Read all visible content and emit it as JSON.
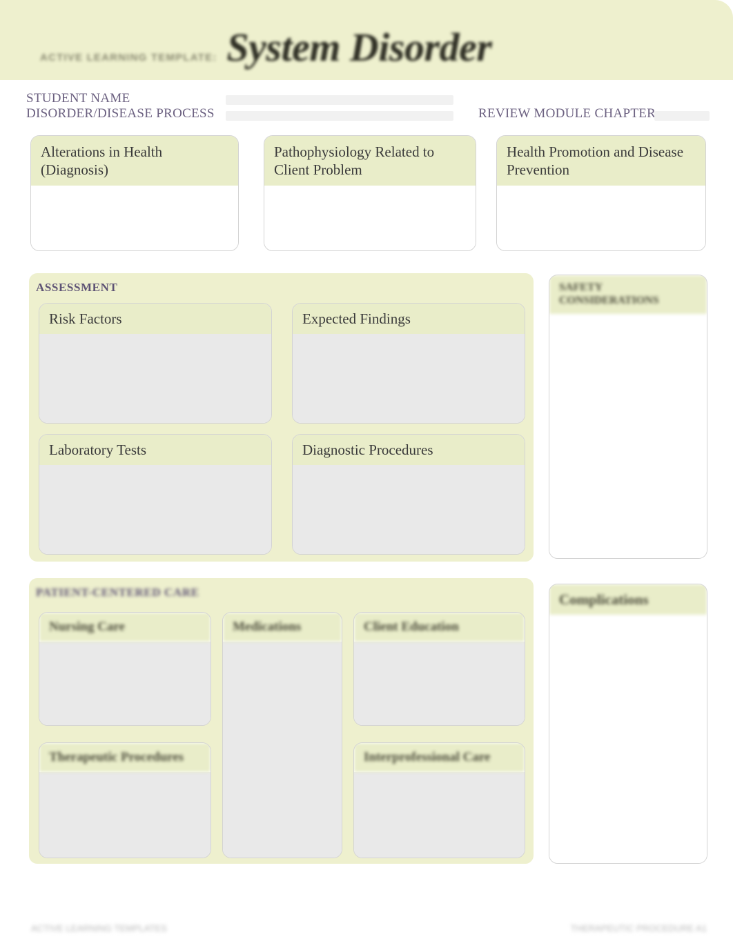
{
  "header": {
    "eyebrow": "ACTIVE LEARNING TEMPLATE:",
    "title": "System Disorder"
  },
  "id_row": {
    "student_name_label": "STUDENT NAME",
    "disorder_label": "DISORDER/DISEASE PROCESS",
    "review_module_label": "REVIEW MODULE CHAPTER",
    "student_name_value": "",
    "disorder_value": "",
    "review_module_value": ""
  },
  "top_boxes": [
    {
      "title": "Alterations in Health (Diagnosis)",
      "value": ""
    },
    {
      "title": "Pathophysiology Related to Client Problem",
      "value": ""
    },
    {
      "title": "Health Promotion and Disease Prevention",
      "value": ""
    }
  ],
  "assessment": {
    "section_title": "ASSESSMENT",
    "boxes": [
      {
        "title": "Risk Factors",
        "value": ""
      },
      {
        "title": "Expected Findings",
        "value": ""
      },
      {
        "title": "Laboratory Tests",
        "value": ""
      },
      {
        "title": "Diagnostic Procedures",
        "value": ""
      }
    ]
  },
  "safety": {
    "title": "SAFETY CONSIDERATIONS",
    "value": ""
  },
  "nursing": {
    "section_title": "PATIENT-CENTERED CARE",
    "boxes": [
      {
        "title": "Nursing Care",
        "value": ""
      },
      {
        "title": "Medications",
        "value": ""
      },
      {
        "title": "Client Education",
        "value": ""
      },
      {
        "title": "Therapeutic Procedures",
        "value": ""
      },
      {
        "title": "Interprofessional Care",
        "value": ""
      }
    ]
  },
  "complications": {
    "title": "Complications",
    "value": ""
  },
  "footer": {
    "left": "ACTIVE LEARNING TEMPLATES",
    "right": "THERAPEUTIC PROCEDURE A1"
  },
  "colors": {
    "banner_green": "#eef0ce",
    "header_green": "#e9edc9",
    "label_purple": "#6b6080",
    "body_gray": "#e9e9e9",
    "border_gray": "#d3d3d3"
  }
}
